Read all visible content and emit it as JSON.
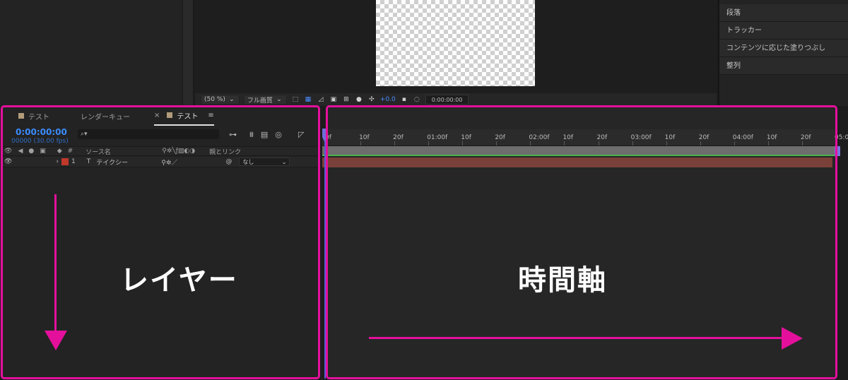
{
  "viewer": {
    "zoom": "(50 %)",
    "resolution": "フル画質",
    "exposure": "+0.0",
    "timecode": "0:00:00:00"
  },
  "right_panel": {
    "items": [
      "段落",
      "トラッカー",
      "コンテンツに応じた塗りつぶし",
      "整列"
    ]
  },
  "tabs": [
    {
      "label": "テスト"
    },
    {
      "label": "レンダーキュー"
    },
    {
      "label": "テスト"
    }
  ],
  "comp": {
    "timecode": "0:00:00:00",
    "fps": "00000 (30.00 fps)",
    "search_placeholder": "⌕▾"
  },
  "columns": {
    "num": "#",
    "source": "ソース名",
    "parent": "親とリンク"
  },
  "layers": [
    {
      "index": "1",
      "type": "T",
      "name": "テイクシー",
      "parent": "なし",
      "color": "#c0392b"
    }
  ],
  "ruler": [
    "0f",
    "10f",
    "20f",
    "01:00f",
    "10f",
    "20f",
    "02:00f",
    "10f",
    "20f",
    "03:00f",
    "10f",
    "20f",
    "04:00f",
    "10f",
    "20f",
    "05:0"
  ],
  "annotations": {
    "layer_label": "レイヤー",
    "time_label": "時間軸",
    "accent": "#e4109c"
  }
}
